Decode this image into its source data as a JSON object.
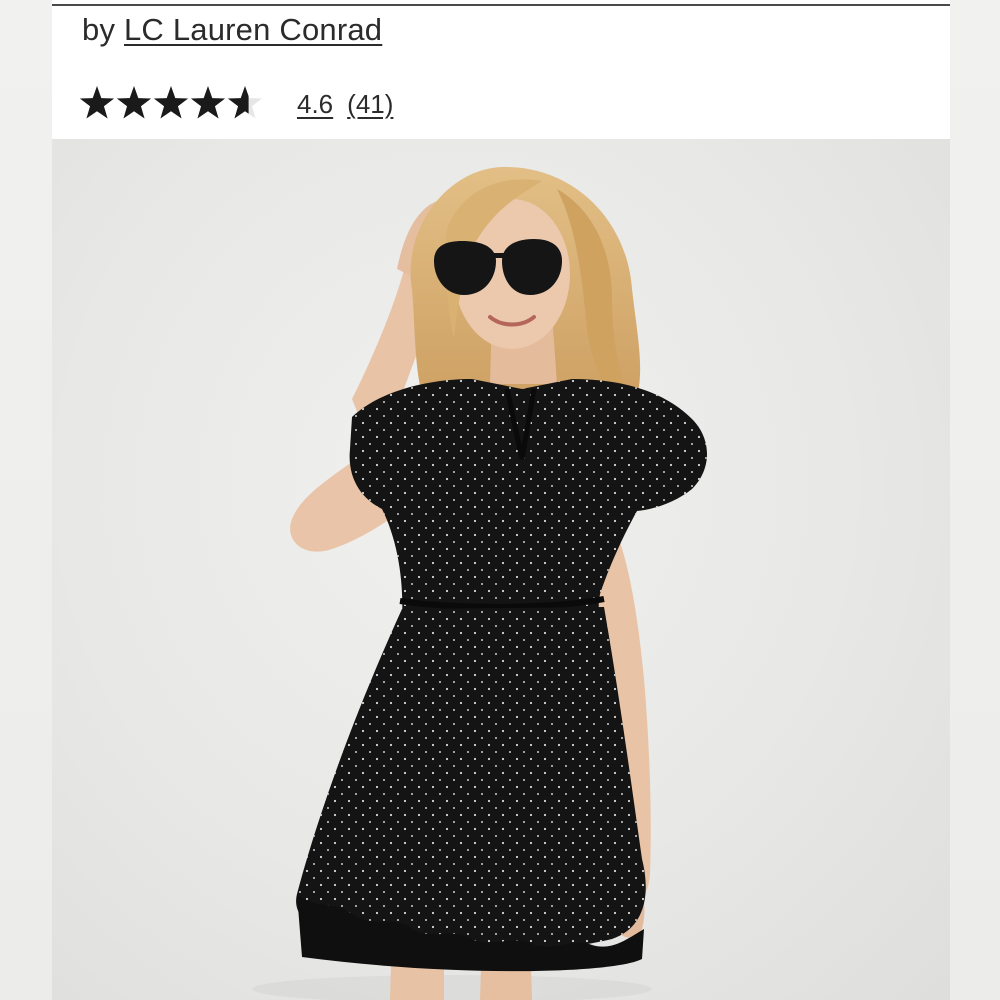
{
  "product": {
    "by_prefix": "by",
    "brand": "LC Lauren Conrad"
  },
  "rating": {
    "value_text": "4.6",
    "count_text": "(41)",
    "stars_max": 5,
    "stars_fill_fraction": 0.92,
    "star_color": "#1a1a1a",
    "star_empty_color": "#e6e6e6"
  },
  "photo": {
    "subject": "model-in-black-polka-dot-dress",
    "dress_color": "#141414",
    "dot_color": "#d8d8d8",
    "hair_color": "#d3ab6e",
    "skin_color": "#e9c4a8"
  }
}
